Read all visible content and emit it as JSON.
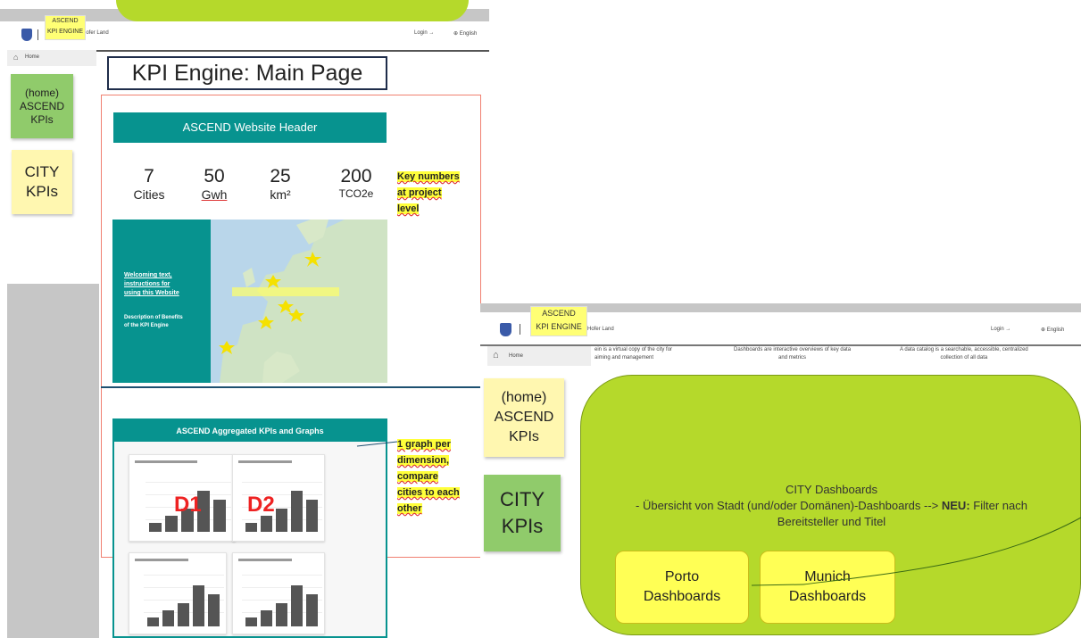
{
  "left_shot": {
    "tooltip": {
      "line1": "ASCEND",
      "line2": "KPI ENGINE"
    },
    "appbar": {
      "brand_tail": "Hofer Land",
      "login": "Login →",
      "language": "⊕ English"
    },
    "nav": {
      "home": "Home"
    },
    "stickies": {
      "home": [
        "(home)",
        "ASCEND",
        "KPIs"
      ],
      "city": [
        "CITY",
        "KPIs"
      ]
    },
    "page_title": "KPI Engine: Main Page",
    "header_banner": "ASCEND Website Header",
    "kpis": [
      {
        "value": "7",
        "unit": "Cities"
      },
      {
        "value": "50",
        "unit": "Gwh"
      },
      {
        "value": "25",
        "unit": "km²"
      },
      {
        "value": "200",
        "unit": "TCO2e"
      }
    ],
    "note_key_numbers": [
      "Key numbers",
      "at project",
      "level"
    ],
    "welcome_text": [
      "Welcoming text,",
      "instructions for",
      "using this Website"
    ],
    "benefits_text": [
      "Description of Benefits",
      "of the KPI Engine"
    ],
    "aggregated_header": "ASCEND Aggregated KPIs and Graphs",
    "note_graph": [
      "1 graph per",
      "dimension,",
      "compare",
      "cities to each",
      "other"
    ],
    "chart_labels": [
      "D1",
      "D2"
    ]
  },
  "right_shot": {
    "tooltip": {
      "line1": "ASCEND",
      "line2": "KPI ENGINE"
    },
    "appbar": {
      "brand_tail": "Hofer Land",
      "login": "Login →",
      "language": "⊕ English"
    },
    "nav": {
      "home": "Home"
    },
    "stickies": {
      "home": [
        "(home)",
        "ASCEND",
        "KPIs"
      ],
      "city": [
        "CITY",
        "KPIs"
      ]
    },
    "top_texts": [
      [
        "ein is a virtual copy of the city for",
        "aiming and management"
      ],
      [
        "Dashboards are interactive overviews of key data",
        "and metrics"
      ],
      [
        "A data catalog is a searchable, accessible, centralized",
        "collection of all data"
      ]
    ],
    "panel_title": "CITY Dashboards",
    "panel_line1_pre": "- Übersicht von Stadt (und/oder Domänen)-Dashboards --> ",
    "panel_line1_bold": "NEU:",
    "panel_line1_post": " Filter nach",
    "panel_line2": "Bereitsteller und Titel",
    "buttons": [
      {
        "line1": "Porto",
        "line2": "Dashboards"
      },
      {
        "line1": "Munich",
        "line2": "Dashboards"
      }
    ]
  },
  "colors": {
    "teal": "#07938f",
    "lime": "#b5d92b",
    "sticky_yellow": "#fff7b0",
    "sticky_green": "#90cb6b",
    "note_yellow": "#ffff3a"
  }
}
